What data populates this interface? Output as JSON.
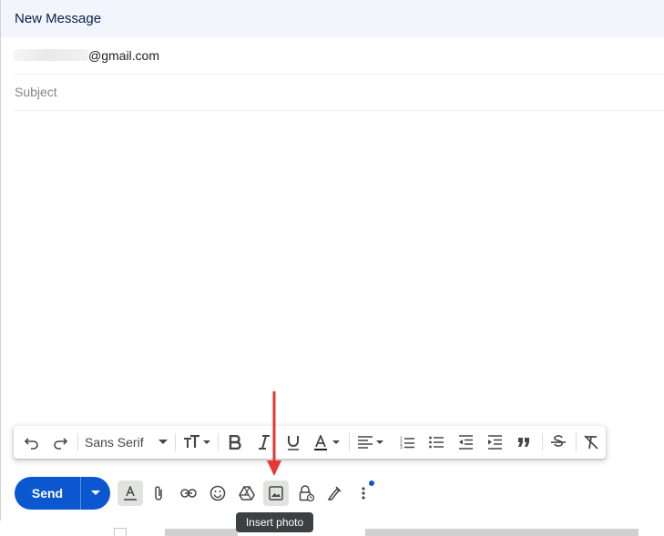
{
  "window": {
    "title": "New Message"
  },
  "to": {
    "visible_text": "@gmail.com"
  },
  "subject": {
    "placeholder": "Subject"
  },
  "formatting": {
    "font": "Sans Serif"
  },
  "send": {
    "label": "Send"
  },
  "tooltip": {
    "text": "Insert photo"
  },
  "colors": {
    "accent": "#0b57d0",
    "header_bg": "#f2f6fc",
    "annotation": "#e53935",
    "tooltip_bg": "#3c4043"
  },
  "icons": {
    "format_bar": [
      "undo-icon",
      "redo-icon",
      "font-size-icon",
      "bold-icon",
      "italic-icon",
      "underline-icon",
      "text-color-icon",
      "align-icon",
      "numbered-list-icon",
      "bulleted-list-icon",
      "indent-less-icon",
      "indent-more-icon",
      "quote-icon",
      "strikethrough-icon",
      "remove-formatting-icon"
    ],
    "bottom_bar": [
      "formatting-options-icon",
      "attach-icon",
      "link-icon",
      "emoji-icon",
      "drive-icon",
      "insert-photo-icon",
      "confidential-mode-icon",
      "signature-icon",
      "more-options-icon"
    ]
  }
}
